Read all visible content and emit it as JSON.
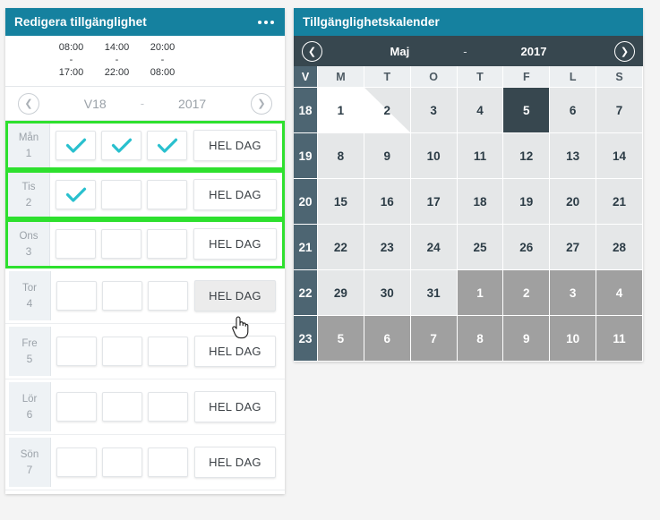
{
  "edit_panel": {
    "title": "Redigera tillgänglighet",
    "menu_icon": "more-options-icon",
    "shifts": [
      {
        "start": "08:00",
        "sep": "-",
        "end": "17:00"
      },
      {
        "start": "14:00",
        "sep": "-",
        "end": "22:00"
      },
      {
        "start": "20:00",
        "sep": "-",
        "end": "08:00"
      }
    ],
    "week_nav": {
      "prev_icon": "chevron-left-icon",
      "next_icon": "chevron-right-icon",
      "week": "V18",
      "dash": "-",
      "year": "2017"
    },
    "full_day_label": "HEL DAG",
    "days": [
      {
        "name": "Mån",
        "num": "1",
        "selected": true,
        "checks": [
          true,
          true,
          true
        ],
        "full_day_hovered": false
      },
      {
        "name": "Tis",
        "num": "2",
        "selected": true,
        "checks": [
          true,
          false,
          false
        ],
        "full_day_hovered": false
      },
      {
        "name": "Ons",
        "num": "3",
        "selected": true,
        "checks": [
          false,
          false,
          false
        ],
        "full_day_hovered": false
      },
      {
        "name": "Tor",
        "num": "4",
        "selected": false,
        "checks": [
          false,
          false,
          false
        ],
        "full_day_hovered": true
      },
      {
        "name": "Fre",
        "num": "5",
        "selected": false,
        "checks": [
          false,
          false,
          false
        ],
        "full_day_hovered": false
      },
      {
        "name": "Lör",
        "num": "6",
        "selected": false,
        "checks": [
          false,
          false,
          false
        ],
        "full_day_hovered": false
      },
      {
        "name": "Sön",
        "num": "7",
        "selected": false,
        "checks": [
          false,
          false,
          false
        ],
        "full_day_hovered": false
      }
    ]
  },
  "calendar_panel": {
    "title": "Tillgänglighetskalender",
    "nav": {
      "prev_icon": "chevron-left-icon",
      "next_icon": "chevron-right-icon",
      "month": "Maj",
      "dash": "-",
      "year": "2017"
    },
    "headers": [
      "V",
      "M",
      "T",
      "O",
      "T",
      "F",
      "L",
      "S"
    ],
    "weeks": [
      {
        "week": "18",
        "days": [
          {
            "label": "1",
            "state": "free"
          },
          {
            "label": "2",
            "state": "half"
          },
          {
            "label": "3",
            "state": "normal"
          },
          {
            "label": "4",
            "state": "normal"
          },
          {
            "label": "5",
            "state": "today"
          },
          {
            "label": "6",
            "state": "normal"
          },
          {
            "label": "7",
            "state": "normal"
          }
        ]
      },
      {
        "week": "19",
        "days": [
          {
            "label": "8",
            "state": "normal"
          },
          {
            "label": "9",
            "state": "normal"
          },
          {
            "label": "10",
            "state": "normal"
          },
          {
            "label": "11",
            "state": "normal"
          },
          {
            "label": "12",
            "state": "normal"
          },
          {
            "label": "13",
            "state": "normal"
          },
          {
            "label": "14",
            "state": "normal"
          }
        ]
      },
      {
        "week": "20",
        "days": [
          {
            "label": "15",
            "state": "normal"
          },
          {
            "label": "16",
            "state": "normal"
          },
          {
            "label": "17",
            "state": "normal"
          },
          {
            "label": "18",
            "state": "normal"
          },
          {
            "label": "19",
            "state": "normal"
          },
          {
            "label": "20",
            "state": "normal"
          },
          {
            "label": "21",
            "state": "normal"
          }
        ]
      },
      {
        "week": "21",
        "days": [
          {
            "label": "22",
            "state": "normal"
          },
          {
            "label": "23",
            "state": "normal"
          },
          {
            "label": "24",
            "state": "normal"
          },
          {
            "label": "25",
            "state": "normal"
          },
          {
            "label": "26",
            "state": "normal"
          },
          {
            "label": "27",
            "state": "normal"
          },
          {
            "label": "28",
            "state": "normal"
          }
        ]
      },
      {
        "week": "22",
        "days": [
          {
            "label": "29",
            "state": "normal"
          },
          {
            "label": "30",
            "state": "normal"
          },
          {
            "label": "31",
            "state": "normal"
          },
          {
            "label": "1",
            "state": "othermonth"
          },
          {
            "label": "2",
            "state": "othermonth"
          },
          {
            "label": "3",
            "state": "othermonth"
          },
          {
            "label": "4",
            "state": "othermonth"
          }
        ]
      },
      {
        "week": "23",
        "days": [
          {
            "label": "5",
            "state": "othermonth"
          },
          {
            "label": "6",
            "state": "othermonth"
          },
          {
            "label": "7",
            "state": "othermonth"
          },
          {
            "label": "8",
            "state": "othermonth"
          },
          {
            "label": "9",
            "state": "othermonth"
          },
          {
            "label": "10",
            "state": "othermonth"
          },
          {
            "label": "11",
            "state": "othermonth"
          }
        ]
      }
    ]
  },
  "colors": {
    "panel_header": "#15819f",
    "calendar_nav": "#37474f",
    "week_column": "#4d6572",
    "selected_row_border": "#2ee02e",
    "check_mark": "#29c0ce",
    "today_cell": "#37474f",
    "other_month_cell": "#a0a0a0",
    "page_background": "#f4f4f4"
  },
  "cursor": {
    "icon": "pointing-hand-cursor"
  }
}
